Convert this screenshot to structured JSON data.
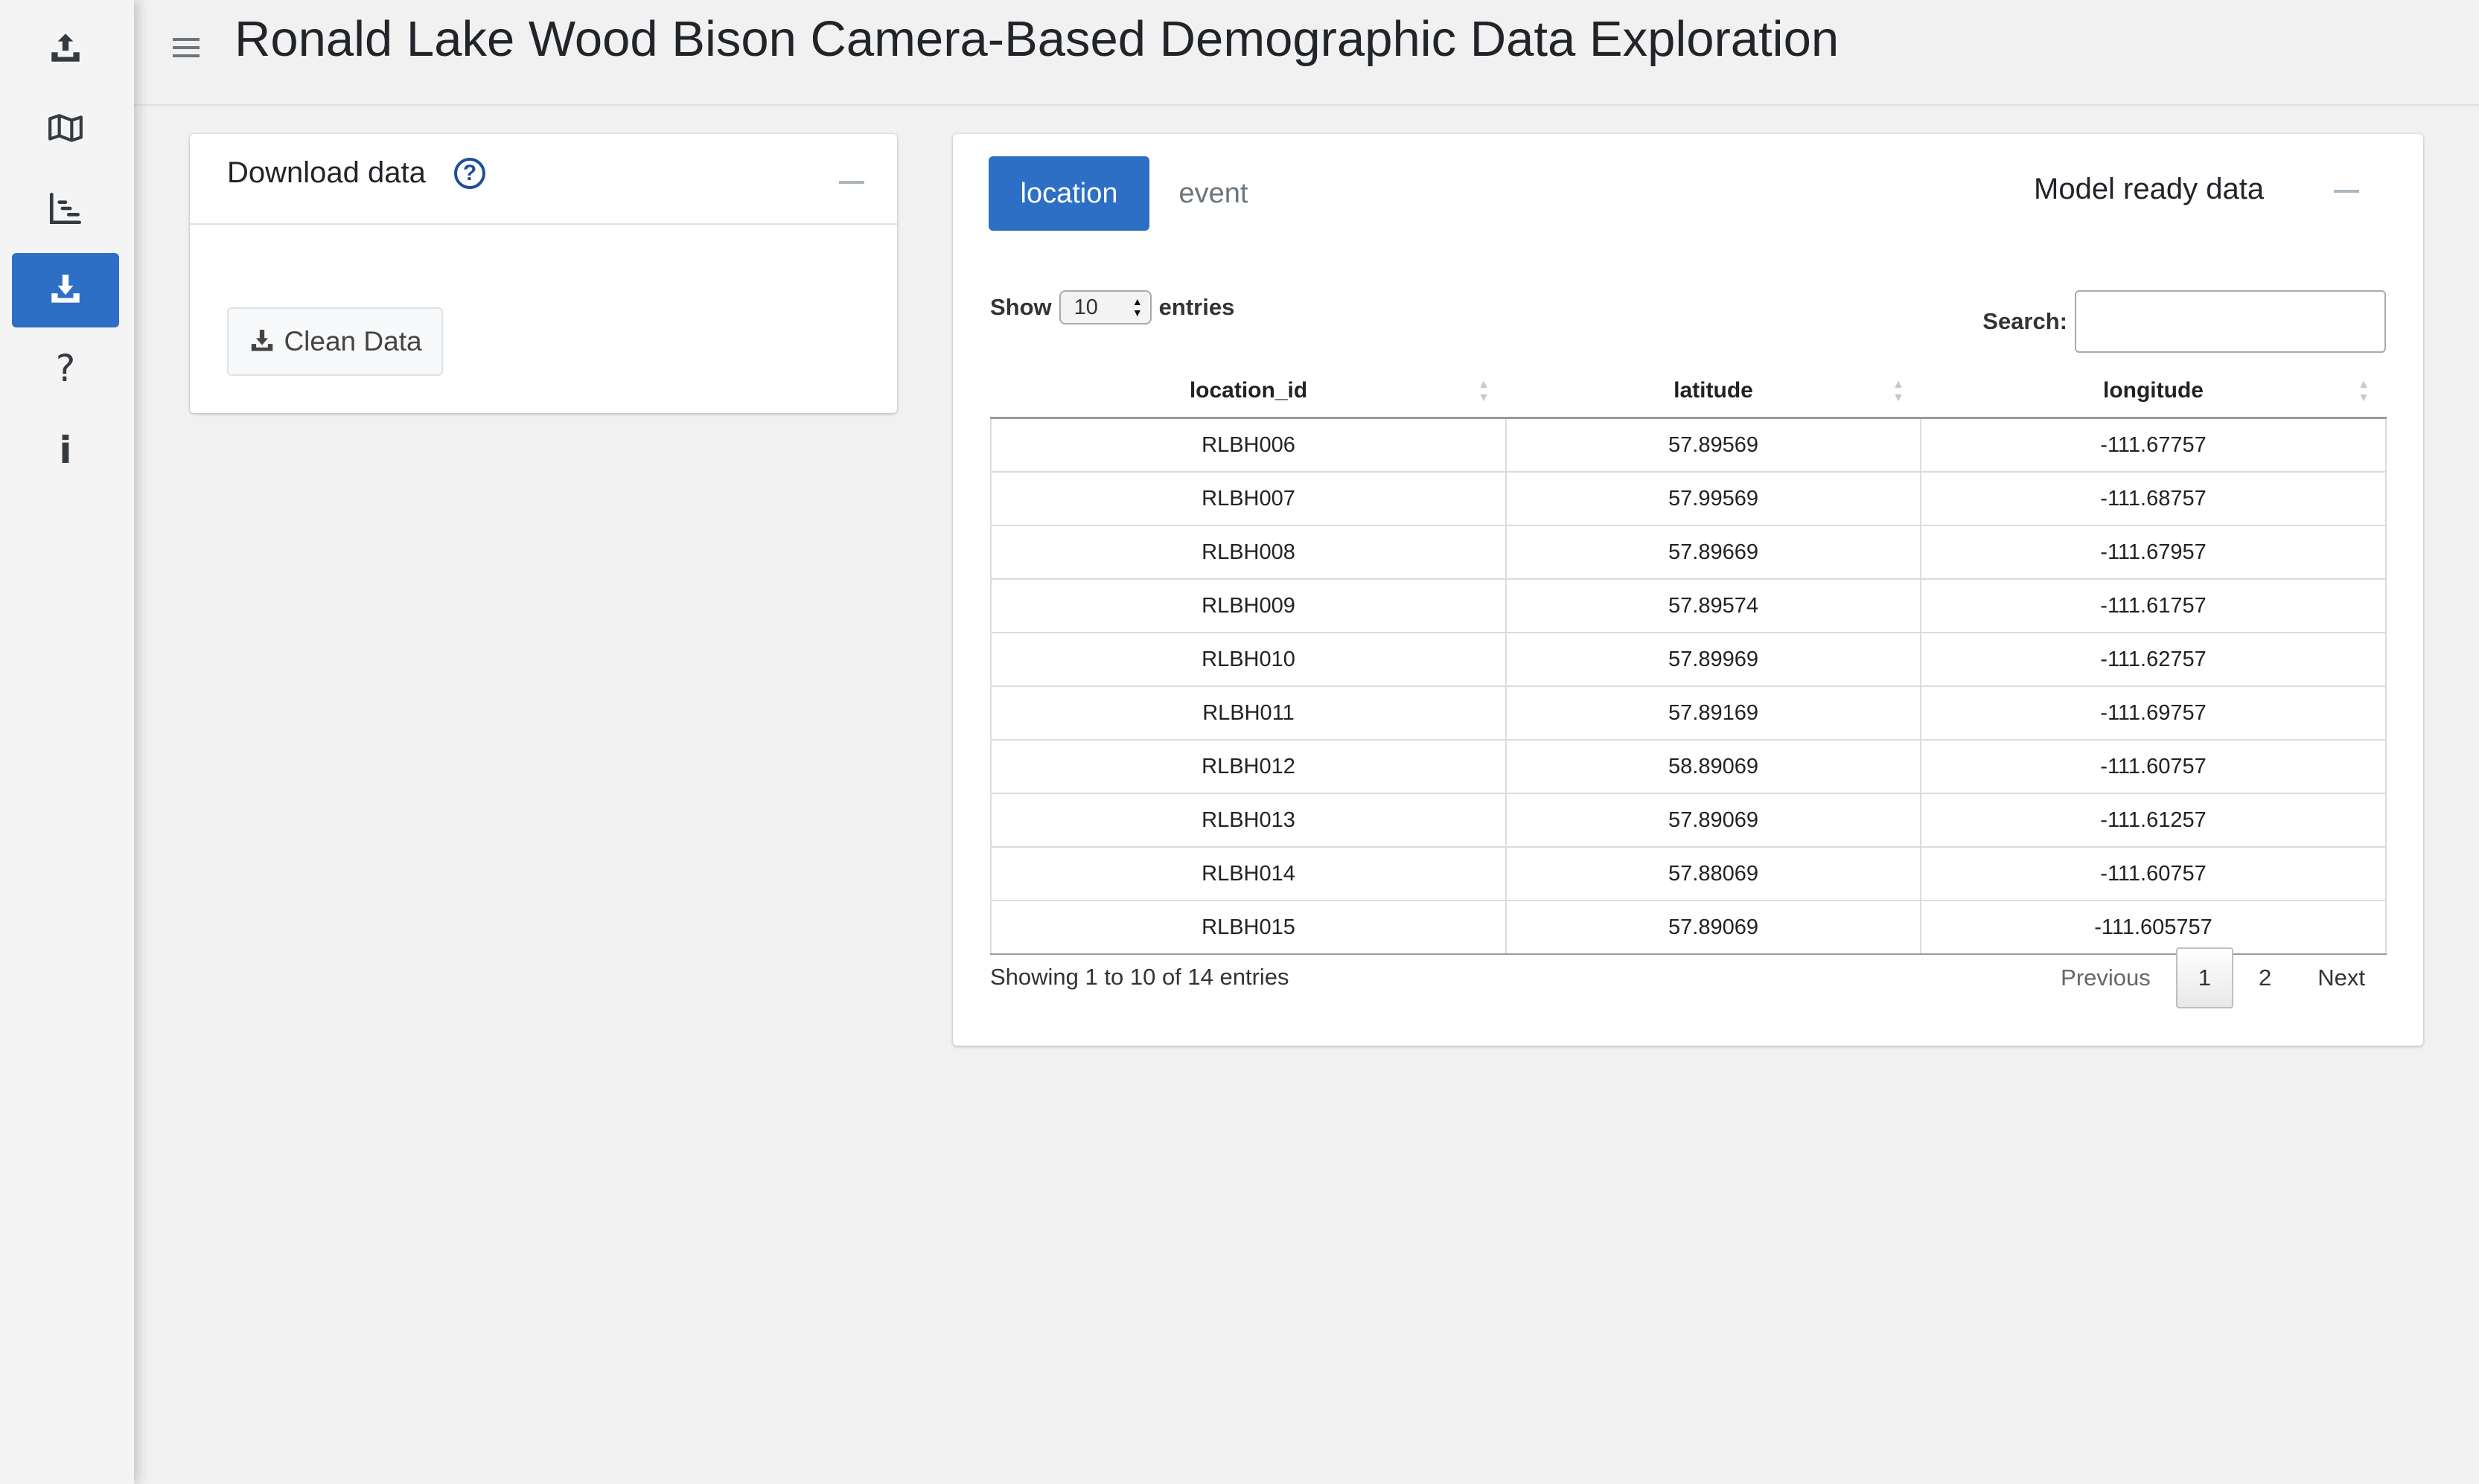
{
  "app": {
    "title": "Ronald Lake Wood Bison Camera-Based Demographic Data Exploration"
  },
  "sidebar": {
    "items": [
      {
        "icon": "upload-icon",
        "active": false
      },
      {
        "icon": "map-icon",
        "active": false
      },
      {
        "icon": "chart-icon",
        "active": false
      },
      {
        "icon": "download-icon",
        "active": true
      },
      {
        "icon": "question-icon",
        "active": false,
        "glyph": "?"
      },
      {
        "icon": "info-icon",
        "active": false,
        "glyph": "i"
      }
    ]
  },
  "download_card": {
    "title": "Download data",
    "help_glyph": "?",
    "button_label": "Clean Data"
  },
  "model_card": {
    "tabs": [
      "location",
      "event"
    ],
    "active_tab": "location",
    "title": "Model ready data",
    "show_label": "Show",
    "page_length": "10",
    "entries_label": "entries",
    "search_label": "Search:",
    "search_value": "",
    "columns": [
      "location_id",
      "latitude",
      "longitude"
    ],
    "rows": [
      [
        "RLBH006",
        "57.89569",
        "-111.67757"
      ],
      [
        "RLBH007",
        "57.99569",
        "-111.68757"
      ],
      [
        "RLBH008",
        "57.89669",
        "-111.67957"
      ],
      [
        "RLBH009",
        "57.89574",
        "-111.61757"
      ],
      [
        "RLBH010",
        "57.89969",
        "-111.62757"
      ],
      [
        "RLBH011",
        "57.89169",
        "-111.69757"
      ],
      [
        "RLBH012",
        "58.89069",
        "-111.60757"
      ],
      [
        "RLBH013",
        "57.89069",
        "-111.61257"
      ],
      [
        "RLBH014",
        "57.88069",
        "-111.60757"
      ],
      [
        "RLBH015",
        "57.89069",
        "-111.605757"
      ]
    ],
    "info": "Showing 1 to 10 of 14 entries",
    "pagination": {
      "previous": "Previous",
      "pages": [
        "1",
        "2"
      ],
      "current": "1",
      "next": "Next"
    }
  }
}
